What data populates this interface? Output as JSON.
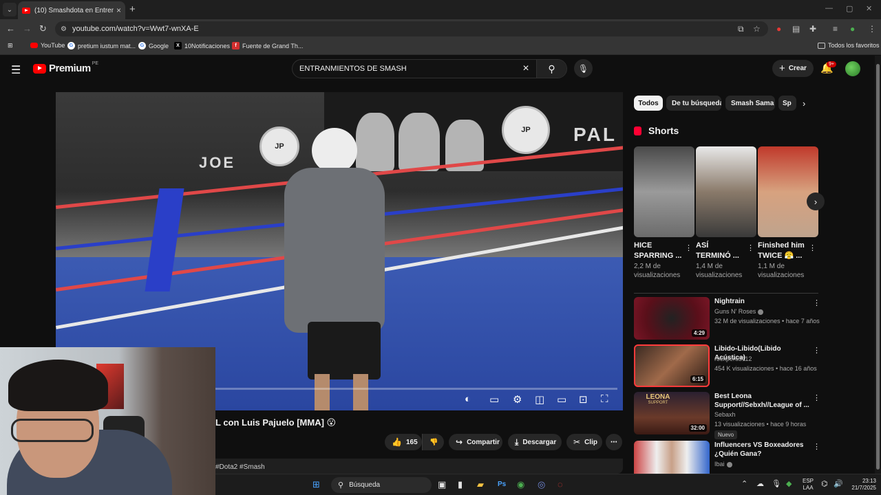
{
  "browser": {
    "tab_title": "(10) Smashdota en Entrenamiento",
    "url": "youtube.com/watch?v=Wwt7-wnXA-E",
    "bookmarks": [
      "YouTube",
      "pretium iustum mat...",
      "Google",
      "10Notificaciones",
      "Fuente de Grand Th..."
    ],
    "all_bookmarks": "Todos los favoritos"
  },
  "header": {
    "logo": "Premium",
    "region": "PE",
    "search_value": "ENTRANMIENTOS DE SMASH",
    "create_label": "Crear",
    "notifications_badge": "9+"
  },
  "video": {
    "overlay_joe": "JOE",
    "overlay_pal": "PAL",
    "overlay_logo": "JP",
    "title": "L con Luis Pajuelo [MMA] 😮",
    "like_count": "165",
    "share_label": "Compartir",
    "download_label": "Descargar",
    "clip_label": "Clip",
    "description_tags": "#Dota2 #Smash"
  },
  "chips": [
    "Todos",
    "De tu búsqueda",
    "Smash Sama",
    "Sp"
  ],
  "shorts": {
    "heading": "Shorts",
    "items": [
      {
        "title": "HICE SPARRING ...",
        "views": "2,2 M de visualizaciones"
      },
      {
        "title": "ASÍ TERMINÓ ...",
        "views": "1,4 M de visualizaciones"
      },
      {
        "title": "Finished him TWICE 😤 ...",
        "views": "1,1 M de visualizaciones"
      }
    ]
  },
  "related": [
    {
      "title": "Nightrain",
      "channel": "Guns N' Roses",
      "meta": "32 M de visualizaciones • hace 7 años",
      "duration": "4:29"
    },
    {
      "title": "Libido-Libido(Libido Acústica)",
      "channel": "rockperu3112",
      "meta": "454 K visualizaciones • hace 16 años",
      "duration": "6:15"
    },
    {
      "title": "Best Leona Support//Sebxh//League of ...",
      "channel": "Sebaxh",
      "meta": "13 visualizaciones • hace 9 horas",
      "duration": "32:00",
      "badge": "Nuevo",
      "thumb_text": "LEONA",
      "thumb_sub": "SUPPORT"
    },
    {
      "title": "Influencers VS Boxeadores ¿Quién Gana?",
      "channel": "Ibai",
      "meta": "",
      "duration": ""
    }
  ],
  "taskbar": {
    "search_label": "Búsqueda",
    "lang_top": "ESP",
    "lang_bottom": "LAA",
    "time": "23:13",
    "date": "21/7/2025"
  },
  "colors": {
    "background": "#0f0f0f",
    "brand_red": "#ff0000",
    "chip_active": "#f1f1f1",
    "panel": "#272727"
  }
}
